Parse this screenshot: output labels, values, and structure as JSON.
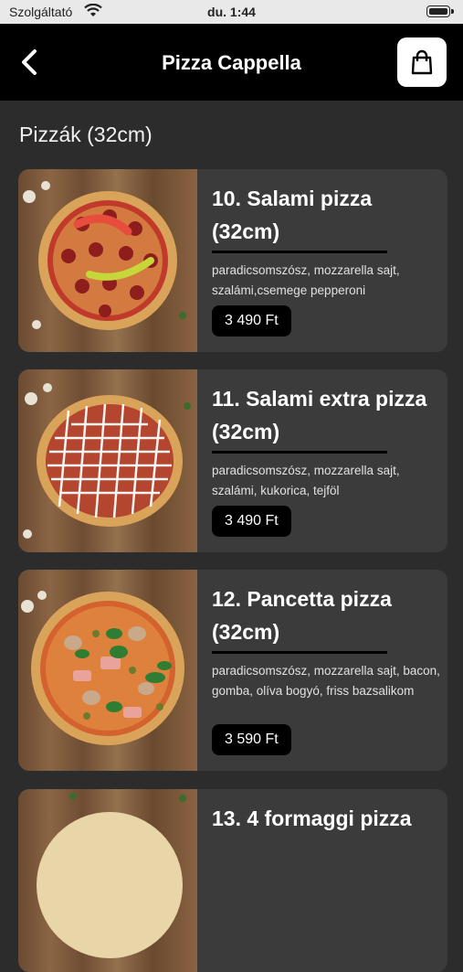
{
  "status": {
    "carrier": "Szolgáltató",
    "time": "du. 1:44"
  },
  "header": {
    "title": "Pizza Cappella",
    "back_icon": "chevron-left-icon",
    "cart_icon": "shopping-bag-icon"
  },
  "section_title": "Pizzák (32cm)",
  "products": [
    {
      "name": "10. Salami pizza (32cm)",
      "description": "paradicsomszósz, mozzarella sajt, szalámi,csemege pepperoni",
      "price": "3 490 Ft"
    },
    {
      "name": "11. Salami extra pizza (32cm)",
      "description": "paradicsomszósz, mozzarella sajt, szalámi, kukorica, tejföl",
      "price": "3 490 Ft"
    },
    {
      "name": "12. Pancetta pizza (32cm)",
      "description": "paradicsomszósz, mozzarella sajt, bacon, gomba, olíva bogyó, friss bazsalikom",
      "price": "3 590 Ft"
    },
    {
      "name": "13. 4 formaggi pizza",
      "description": "",
      "price": ""
    }
  ],
  "colors": {
    "background": "#2c2c2c",
    "card": "#3b3b3b",
    "navbar": "#000000"
  }
}
